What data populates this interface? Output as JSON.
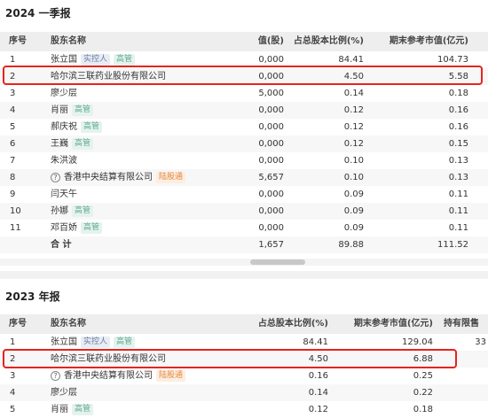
{
  "section1": {
    "title": "2024 一季报",
    "headers": {
      "idx": "序号",
      "name": "股东名称",
      "shares": "值(股)",
      "ratio": "占总股本比例(%)",
      "value": "期末参考市值(亿元)"
    },
    "rows": [
      {
        "idx": "1",
        "name": "张立国",
        "tags": [
          "实控人",
          "高管"
        ],
        "shares": "0,000",
        "ratio": "84.41",
        "value": "104.73"
      },
      {
        "idx": "2",
        "name": "哈尔滨三联药业股份有限公司",
        "tags": [],
        "shares": "0,000",
        "ratio": "4.50",
        "value": "5.58"
      },
      {
        "idx": "3",
        "name": "廖少层",
        "tags": [],
        "shares": "5,000",
        "ratio": "0.14",
        "value": "0.18"
      },
      {
        "idx": "4",
        "name": "肖丽",
        "tags": [
          "高管"
        ],
        "shares": "0,000",
        "ratio": "0.12",
        "value": "0.16"
      },
      {
        "idx": "5",
        "name": "郝庆祝",
        "tags": [
          "高管"
        ],
        "shares": "0,000",
        "ratio": "0.12",
        "value": "0.16"
      },
      {
        "idx": "6",
        "name": "王巍",
        "tags": [
          "高管"
        ],
        "shares": "0,000",
        "ratio": "0.12",
        "value": "0.15"
      },
      {
        "idx": "7",
        "name": "朱洪波",
        "tags": [],
        "shares": "0,000",
        "ratio": "0.10",
        "value": "0.13"
      },
      {
        "idx": "8",
        "name": "香港中央结算有限公司",
        "tags": [
          "陆股通"
        ],
        "shares": "5,657",
        "ratio": "0.10",
        "value": "0.13",
        "question": "?"
      },
      {
        "idx": "9",
        "name": "闫天午",
        "tags": [],
        "shares": "0,000",
        "ratio": "0.09",
        "value": "0.11"
      },
      {
        "idx": "10",
        "name": "孙娜",
        "tags": [
          "高管"
        ],
        "shares": "0,000",
        "ratio": "0.09",
        "value": "0.11"
      },
      {
        "idx": "11",
        "name": "邓百娇",
        "tags": [
          "高管"
        ],
        "shares": "0,000",
        "ratio": "0.09",
        "value": "0.11"
      }
    ],
    "total": {
      "label": "合 计",
      "shares": "1,657",
      "ratio": "89.88",
      "value": "111.52"
    }
  },
  "section2": {
    "title": "2023 年报",
    "headers": {
      "idx": "序号",
      "name": "股东名称",
      "ratio": "占总股本比例(%)",
      "value": "期末参考市值(亿元)",
      "limited": "持有限售"
    },
    "rows": [
      {
        "idx": "1",
        "name": "张立国",
        "tags": [
          "实控人",
          "高管"
        ],
        "ratio": "84.41",
        "value": "129.04",
        "limited": "33"
      },
      {
        "idx": "2",
        "name": "哈尔滨三联药业股份有限公司",
        "tags": [],
        "ratio": "4.50",
        "value": "6.88",
        "limited": ""
      },
      {
        "idx": "3",
        "name": "香港中央结算有限公司",
        "tags": [
          "陆股通"
        ],
        "ratio": "0.16",
        "value": "0.25",
        "limited": "",
        "question": "?"
      },
      {
        "idx": "4",
        "name": "廖少层",
        "tags": [],
        "ratio": "0.14",
        "value": "0.22",
        "limited": ""
      },
      {
        "idx": "5",
        "name": "肖丽",
        "tags": [
          "高管"
        ],
        "ratio": "0.12",
        "value": "0.18",
        "limited": ""
      }
    ]
  },
  "colors": {
    "highlight": "#e8231c",
    "exec_tag": "#5fa88d",
    "ctrl_tag": "#6c7da0",
    "hk_tag": "#e28a3c"
  }
}
